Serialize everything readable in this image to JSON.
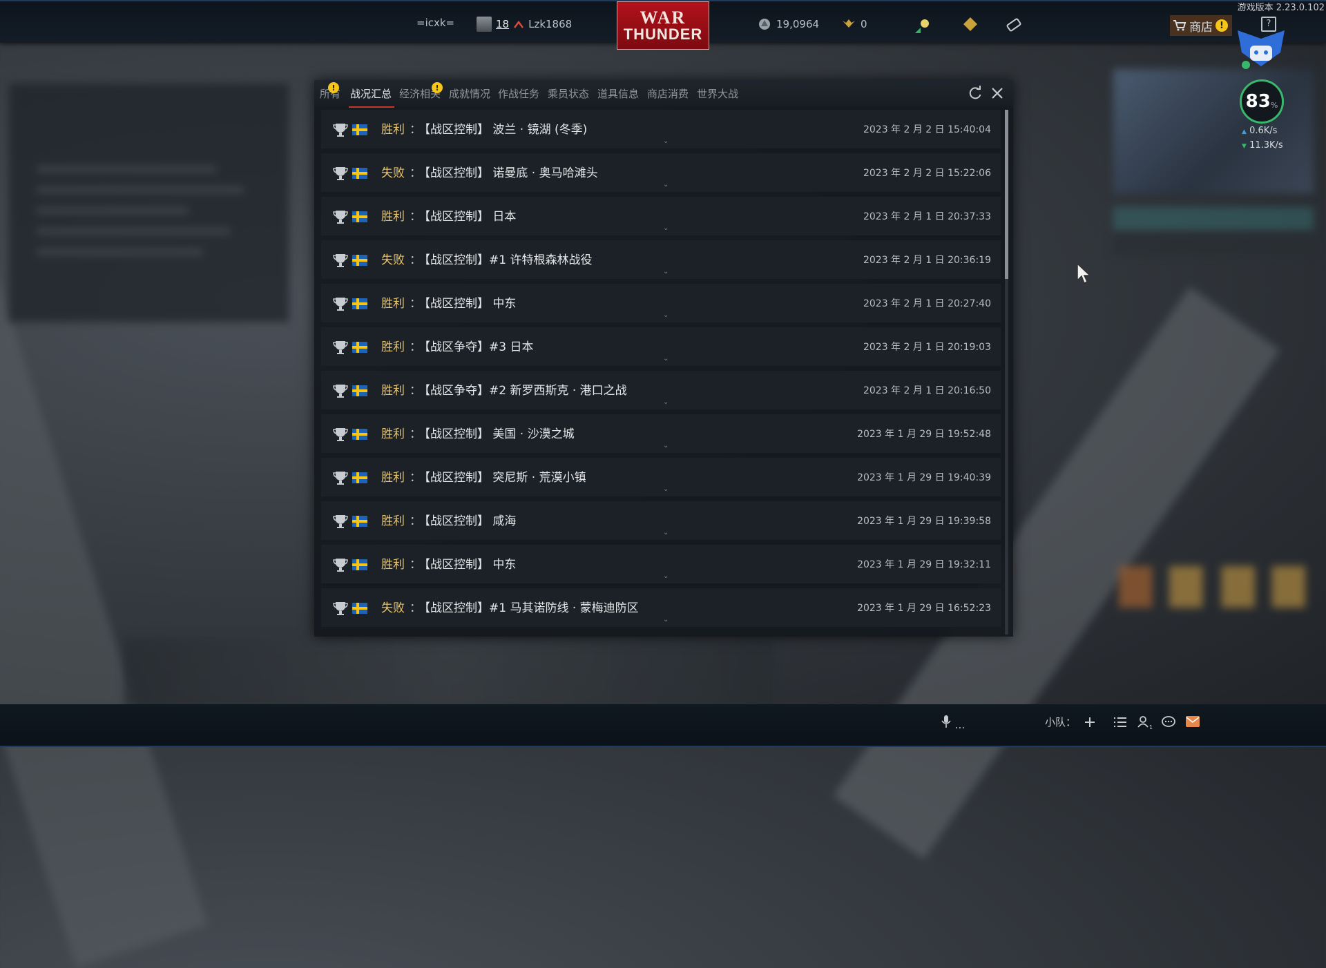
{
  "version": "游戏版本 2.23.0.102",
  "topbar": {
    "squadron": "=icxk=",
    "rank": "18",
    "username": "Lzk1868",
    "logo_line1": "WAR",
    "logo_line2": "THUNDER",
    "silver_lions": "19,0964",
    "golden_eagles": "0",
    "shop_label": "商店"
  },
  "status": {
    "percent": "83",
    "percent_unit": "%",
    "upload": "0.6",
    "download": "11.3",
    "rate_unit": "K/s"
  },
  "dialog": {
    "tabs": [
      {
        "label": "所有",
        "active": false,
        "alert": true
      },
      {
        "label": "战况汇总",
        "active": true,
        "alert": false
      },
      {
        "label": "经济相关",
        "active": false,
        "alert": true
      },
      {
        "label": "成就情况",
        "active": false,
        "alert": false
      },
      {
        "label": "作战任务",
        "active": false,
        "alert": false
      },
      {
        "label": "乘员状态",
        "active": false,
        "alert": false
      },
      {
        "label": "道具信息",
        "active": false,
        "alert": false
      },
      {
        "label": "商店消费",
        "active": false,
        "alert": false
      },
      {
        "label": "世界大战",
        "active": false,
        "alert": false
      }
    ],
    "separator": "：",
    "battles": [
      {
        "result": "胜利",
        "mission": "【战区控制】 波兰 · 镜湖 (冬季)",
        "time": "2023 年 2 月 2 日 15:40:04"
      },
      {
        "result": "失败",
        "mission": "【战区控制】 诺曼底 · 奥马哈滩头",
        "time": "2023 年 2 月 2 日 15:22:06"
      },
      {
        "result": "胜利",
        "mission": "【战区控制】 日本",
        "time": "2023 年 2 月 1 日 20:37:33"
      },
      {
        "result": "失败",
        "mission": "【战区控制】#1 许特根森林战役",
        "time": "2023 年 2 月 1 日 20:36:19"
      },
      {
        "result": "胜利",
        "mission": "【战区控制】 中东",
        "time": "2023 年 2 月 1 日 20:27:40"
      },
      {
        "result": "胜利",
        "mission": "【战区争夺】#3 日本",
        "time": "2023 年 2 月 1 日 20:19:03"
      },
      {
        "result": "胜利",
        "mission": "【战区争夺】#2 新罗西斯克 · 港口之战",
        "time": "2023 年 2 月 1 日 20:16:50"
      },
      {
        "result": "胜利",
        "mission": "【战区控制】 美国 · 沙漠之城",
        "time": "2023 年 1 月 29 日 19:52:48"
      },
      {
        "result": "胜利",
        "mission": "【战区控制】 突尼斯 · 荒漠小镇",
        "time": "2023 年 1 月 29 日 19:40:39"
      },
      {
        "result": "胜利",
        "mission": "【战区控制】 咸海",
        "time": "2023 年 1 月 29 日 19:39:58"
      },
      {
        "result": "胜利",
        "mission": "【战区控制】 中东",
        "time": "2023 年 1 月 29 日 19:32:11"
      },
      {
        "result": "失败",
        "mission": "【战区控制】#1 马其诺防线 · 蒙梅迪防区",
        "time": "2023 年 1 月 29 日 16:52:23"
      }
    ]
  },
  "bottombar": {
    "voice_label": "...",
    "squad_label": "小队："
  }
}
